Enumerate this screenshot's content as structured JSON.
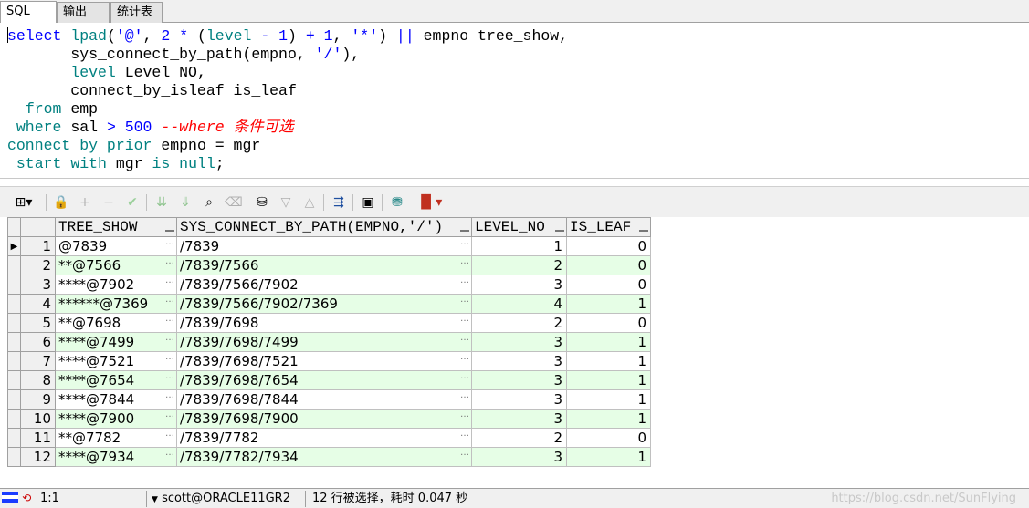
{
  "tabs": [
    {
      "label": "SQL",
      "active": true
    },
    {
      "label": "输出",
      "active": false
    },
    {
      "label": "统计表",
      "active": false
    }
  ],
  "editor": {
    "lines": [
      "select lpad('@', 2 * (level - 1) + 1, '*') || empno tree_show,",
      "       sys_connect_by_path(empno, '/'),",
      "       level Level_NO,",
      "       connect_by_isleaf is_leaf",
      "  from emp",
      " where sal > 500 --where 条件可选",
      "connect by prior empno = mgr",
      " start with mgr is null;"
    ]
  },
  "toolbar": {
    "icons": [
      "grid-view-icon",
      "lock-icon",
      "add-row-icon",
      "delete-row-icon",
      "post-changes-icon",
      "fetch-next-icon",
      "fetch-all-icon",
      "find-icon",
      "clear-icon",
      "query-by-example-icon",
      "filter-icon",
      "sort-icon",
      "export-icon",
      "save-icon",
      "database-icon",
      "chart-icon"
    ]
  },
  "grid": {
    "columns": [
      "TREE_SHOW",
      "SYS_CONNECT_BY_PATH(EMPNO,'/')",
      "LEVEL_NO",
      "IS_LEAF"
    ],
    "rows": [
      {
        "n": "1",
        "tree_show": "@7839",
        "path": "/7839",
        "level": "1",
        "leaf": "0"
      },
      {
        "n": "2",
        "tree_show": "**@7566",
        "path": "/7839/7566",
        "level": "2",
        "leaf": "0"
      },
      {
        "n": "3",
        "tree_show": "****@7902",
        "path": "/7839/7566/7902",
        "level": "3",
        "leaf": "0"
      },
      {
        "n": "4",
        "tree_show": "******@7369",
        "path": "/7839/7566/7902/7369",
        "level": "4",
        "leaf": "1"
      },
      {
        "n": "5",
        "tree_show": "**@7698",
        "path": "/7839/7698",
        "level": "2",
        "leaf": "0"
      },
      {
        "n": "6",
        "tree_show": "****@7499",
        "path": "/7839/7698/7499",
        "level": "3",
        "leaf": "1"
      },
      {
        "n": "7",
        "tree_show": "****@7521",
        "path": "/7839/7698/7521",
        "level": "3",
        "leaf": "1"
      },
      {
        "n": "8",
        "tree_show": "****@7654",
        "path": "/7839/7698/7654",
        "level": "3",
        "leaf": "1"
      },
      {
        "n": "9",
        "tree_show": "****@7844",
        "path": "/7839/7698/7844",
        "level": "3",
        "leaf": "1"
      },
      {
        "n": "10",
        "tree_show": "****@7900",
        "path": "/7839/7698/7900",
        "level": "3",
        "leaf": "1"
      },
      {
        "n": "11",
        "tree_show": "**@7782",
        "path": "/7839/7782",
        "level": "2",
        "leaf": "0"
      },
      {
        "n": "12",
        "tree_show": "****@7934",
        "path": "/7839/7782/7934",
        "level": "3",
        "leaf": "1"
      }
    ]
  },
  "status": {
    "position": "1:1",
    "connection": "scott@ORACLE11GR2",
    "message": "12 行被选择，耗时 0.047 秒",
    "watermark": "https://blog.csdn.net/SunFlying"
  }
}
